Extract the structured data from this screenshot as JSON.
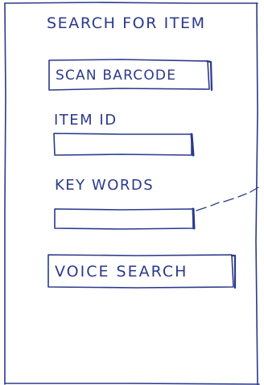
{
  "screen": {
    "title": "SEARCH FOR ITEM",
    "ink_color": "#2b3a8a"
  },
  "scan_button": {
    "label": "SCAN BARCODE"
  },
  "item_id": {
    "label": "ITEM ID",
    "value": ""
  },
  "keywords": {
    "label": "KEY WORDS",
    "value": ""
  },
  "voice_button": {
    "label": "VOICE SEARCH"
  }
}
